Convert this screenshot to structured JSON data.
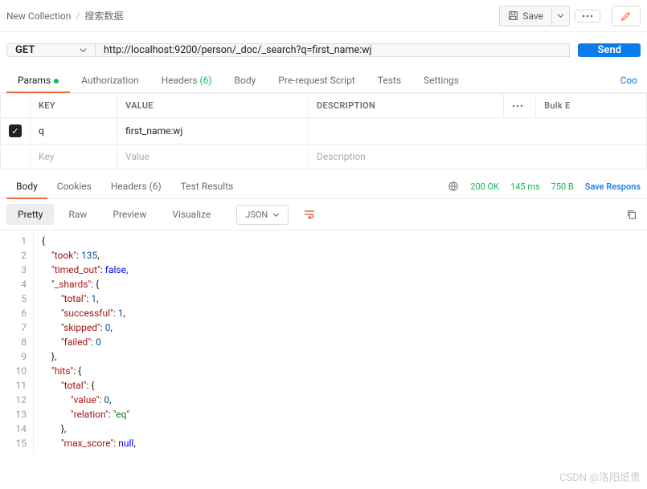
{
  "breadcrumb": {
    "collection": "New Collection",
    "request": "搜索数据"
  },
  "toolbar": {
    "save": "Save"
  },
  "request": {
    "method": "GET",
    "url": "http://localhost:9200/person/_doc/_search?q=first_name:wj",
    "send": "Send"
  },
  "tabs": {
    "params": "Params",
    "auth": "Authorization",
    "headers": "Headers",
    "headers_count": "(6)",
    "body": "Body",
    "prereq": "Pre-request Script",
    "tests": "Tests",
    "settings": "Settings",
    "cookies_link": "Coo"
  },
  "params_table": {
    "head": {
      "key": "KEY",
      "value": "VALUE",
      "desc": "DESCRIPTION",
      "bulk": "Bulk E"
    },
    "rows": [
      {
        "checked": true,
        "key": "q",
        "value": "first_name:wj",
        "desc": ""
      }
    ],
    "placeholder": {
      "key": "Key",
      "value": "Value",
      "desc": "Description"
    }
  },
  "response": {
    "tabs": {
      "body": "Body",
      "cookies": "Cookies",
      "headers": "Headers",
      "headers_count": "(6)",
      "tests": "Test Results"
    },
    "status_code": "200 OK",
    "time": "145 ms",
    "size": "750 B",
    "save": "Save Respons"
  },
  "view": {
    "pretty": "Pretty",
    "raw": "Raw",
    "preview": "Preview",
    "visualize": "Visualize",
    "format": "JSON"
  },
  "json_lines": [
    [
      {
        "t": "p",
        "v": "{"
      }
    ],
    [
      {
        "t": "i",
        "v": "    "
      },
      {
        "t": "k",
        "v": "\"took\""
      },
      {
        "t": "p",
        "v": ": "
      },
      {
        "t": "n",
        "v": "135"
      },
      {
        "t": "p",
        "v": ","
      }
    ],
    [
      {
        "t": "i",
        "v": "    "
      },
      {
        "t": "k",
        "v": "\"timed_out\""
      },
      {
        "t": "p",
        "v": ": "
      },
      {
        "t": "b",
        "v": "false"
      },
      {
        "t": "p",
        "v": ","
      }
    ],
    [
      {
        "t": "i",
        "v": "    "
      },
      {
        "t": "k",
        "v": "\"_shards\""
      },
      {
        "t": "p",
        "v": ": {"
      }
    ],
    [
      {
        "t": "i",
        "v": "        "
      },
      {
        "t": "k",
        "v": "\"total\""
      },
      {
        "t": "p",
        "v": ": "
      },
      {
        "t": "n",
        "v": "1"
      },
      {
        "t": "p",
        "v": ","
      }
    ],
    [
      {
        "t": "i",
        "v": "        "
      },
      {
        "t": "k",
        "v": "\"successful\""
      },
      {
        "t": "p",
        "v": ": "
      },
      {
        "t": "n",
        "v": "1"
      },
      {
        "t": "p",
        "v": ","
      }
    ],
    [
      {
        "t": "i",
        "v": "        "
      },
      {
        "t": "k",
        "v": "\"skipped\""
      },
      {
        "t": "p",
        "v": ": "
      },
      {
        "t": "n",
        "v": "0"
      },
      {
        "t": "p",
        "v": ","
      }
    ],
    [
      {
        "t": "i",
        "v": "        "
      },
      {
        "t": "k",
        "v": "\"failed\""
      },
      {
        "t": "p",
        "v": ": "
      },
      {
        "t": "n",
        "v": "0"
      }
    ],
    [
      {
        "t": "i",
        "v": "    "
      },
      {
        "t": "p",
        "v": "},"
      }
    ],
    [
      {
        "t": "i",
        "v": "    "
      },
      {
        "t": "k",
        "v": "\"hits\""
      },
      {
        "t": "p",
        "v": ": {"
      }
    ],
    [
      {
        "t": "i",
        "v": "        "
      },
      {
        "t": "k",
        "v": "\"total\""
      },
      {
        "t": "p",
        "v": ": {"
      }
    ],
    [
      {
        "t": "i",
        "v": "            "
      },
      {
        "t": "k",
        "v": "\"value\""
      },
      {
        "t": "p",
        "v": ": "
      },
      {
        "t": "n",
        "v": "0"
      },
      {
        "t": "p",
        "v": ","
      }
    ],
    [
      {
        "t": "i",
        "v": "            "
      },
      {
        "t": "k",
        "v": "\"relation\""
      },
      {
        "t": "p",
        "v": ": "
      },
      {
        "t": "s",
        "v": "\"eq\""
      }
    ],
    [
      {
        "t": "i",
        "v": "        "
      },
      {
        "t": "p",
        "v": "},"
      }
    ],
    [
      {
        "t": "i",
        "v": "        "
      },
      {
        "t": "k",
        "v": "\"max_score\""
      },
      {
        "t": "p",
        "v": ": "
      },
      {
        "t": "nl",
        "v": "null"
      },
      {
        "t": "p",
        "v": ","
      }
    ]
  ],
  "watermark": "CSDN @洛阳纸贵"
}
